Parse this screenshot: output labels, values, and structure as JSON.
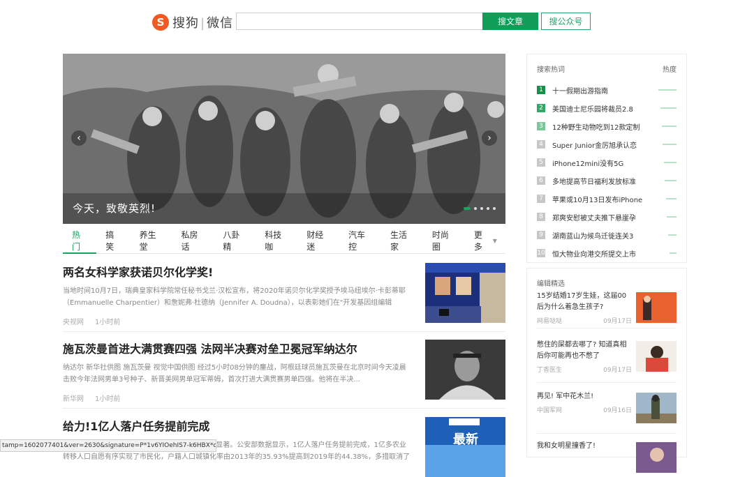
{
  "header": {
    "logo_letter": "S",
    "logo_brand": "搜狗",
    "logo_sep": "|",
    "logo_product": "微信",
    "search_value": "",
    "btn_article": "搜文章",
    "btn_account": "搜公众号"
  },
  "hero": {
    "caption": "今天，致敬英烈!",
    "arrow_left": "‹",
    "arrow_right": "›"
  },
  "tabs": [
    "热门",
    "搞笑",
    "养生堂",
    "私房话",
    "八卦精",
    "科技咖",
    "财经迷",
    "汽车控",
    "生活家",
    "时尚圈",
    "更多"
  ],
  "news": [
    {
      "title": "两名女科学家获诺贝尔化学奖!",
      "summary": "当地时间10月7日，瑞典皇家科学院常任秘书戈兰·汉松宣布，将2020年诺贝尔化学奖授予埃马纽埃尔·卡彭蒂耶（Emmanuelle Charpentier）和詹妮弗·杜德纳（Jennifer A. Doudna），以表彰她们在\"开发基因组编辑",
      "source": "央视网",
      "time": "1小时前"
    },
    {
      "title": "施瓦茨曼首进大满贯赛四强 法网半决赛对垒卫冕冠军纳达尔",
      "summary": "纳达尔 新华社供图 施瓦茨曼 视觉中国供图 经过5小时08分钟的鏖战，阿根廷球员施瓦茨曼在北京时间今天凌晨击败今年法网男单3号种子、新晋美网男单冠军蒂姆，首次打进大满贯赛男单四强。他将在半决...",
      "source": "新华网",
      "time": "1小时前"
    },
    {
      "title": "给力!1亿人落户任务提前完成",
      "summary": "\"十三五\"期间，我国户籍制度改革进展顺利，成效显著。公安部数据显示，1亿人落户任务提前完成，1亿多农业转移人口自愿有序实现了市民化，户籍人口城镇化率由2013年的35.93%提高到2019年的44.38%，多措取消了",
      "source": "",
      "time": ""
    }
  ],
  "hot": {
    "title": "搜索热词",
    "heat_label": "热度",
    "items": [
      {
        "rank": "1",
        "text": "十一假期出游指南",
        "heat": 1.0
      },
      {
        "rank": "2",
        "text": "美国迪士尼乐园将裁员2.8",
        "heat": 0.9
      },
      {
        "rank": "3",
        "text": "12种野生动物吃到12款定制",
        "heat": 0.82
      },
      {
        "rank": "4",
        "text": "Super Junior金厉旭承认恋",
        "heat": 0.76
      },
      {
        "rank": "5",
        "text": "iPhone12mini没有5G",
        "heat": 0.7
      },
      {
        "rank": "6",
        "text": "多地提高节日福利发放标准",
        "heat": 0.64
      },
      {
        "rank": "7",
        "text": "苹果或10月13日发布iPhone",
        "heat": 0.58
      },
      {
        "rank": "8",
        "text": "郑爽安慰被丈夫推下悬崖孕",
        "heat": 0.52
      },
      {
        "rank": "9",
        "text": "湖南蓝山为候鸟迁徙连关3",
        "heat": 0.46
      },
      {
        "rank": "10",
        "text": "恒大物业向港交所提交上市",
        "heat": 0.4
      }
    ]
  },
  "picks": {
    "title": "编辑精选",
    "items": [
      {
        "title": "15岁结婚17岁生娃，这届00后为什么着急生孩子?",
        "source": "网易哒哒",
        "date": "09月17日"
      },
      {
        "title": "憋住的屎都去哪了? 知道真相后你可能再也不憋了",
        "source": "丁香医生",
        "date": "09月17日"
      },
      {
        "title": "再见! 军中花木兰!",
        "source": "中国军网",
        "date": "09月16日"
      },
      {
        "title": "我和女明星撞香了!",
        "source": "",
        "date": ""
      }
    ]
  },
  "statusbar": "tamp=1602077401&ver=2630&signature=P*1v6YIOehIS7-k6HBX*qea6k..."
}
